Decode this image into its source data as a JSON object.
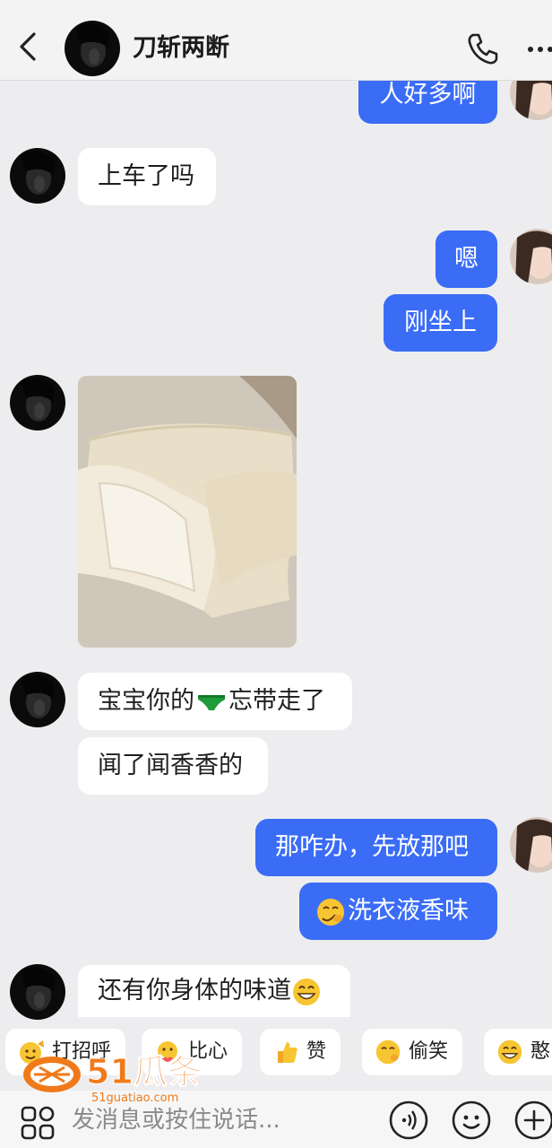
{
  "header": {
    "contact_name": "刀斩两断"
  },
  "messages": {
    "m0": "人好多啊",
    "m1": "上车了吗",
    "m2": "嗯",
    "m3": "刚坐上",
    "m5_a": "宝宝你的",
    "m5_b": "忘带走了",
    "m6": "闻了闻香香的",
    "m7": "那咋办，先放那吧",
    "m8": "洗衣液香味",
    "m9": "还有你身体的味道"
  },
  "quick_replies": [
    {
      "label": "打招呼",
      "icon": "wave-emoji"
    },
    {
      "label": "比心",
      "icon": "heart-hands-emoji"
    },
    {
      "label": "赞",
      "icon": "thumbs-up-emoji"
    },
    {
      "label": "偷笑",
      "icon": "snicker-emoji"
    },
    {
      "label": "憨",
      "icon": "grin-emoji"
    }
  ],
  "watermark": {
    "text": "51瓜条",
    "sub": "51guatiao.com"
  },
  "input": {
    "placeholder": "发消息或按住说话..."
  },
  "colors": {
    "outgoing_bubble": "#3A6CF6",
    "incoming_bubble": "#FFFFFF",
    "background": "#EDEDEF",
    "brand": "#F07A1A"
  }
}
